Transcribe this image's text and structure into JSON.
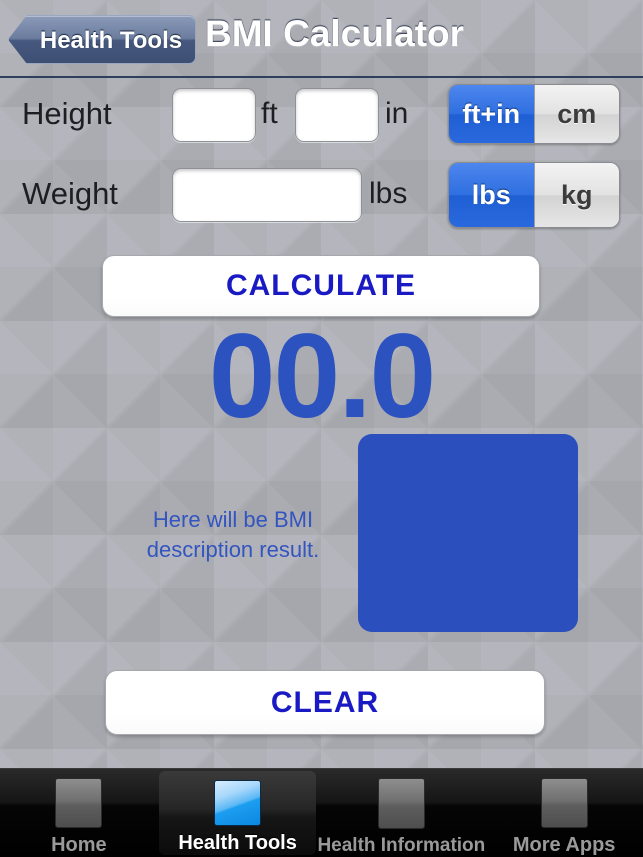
{
  "header": {
    "back_label": "Health Tools",
    "back_icon": "chevron-left-icon",
    "title": "BMI Calculator"
  },
  "form": {
    "height": {
      "label": "Height",
      "feet_value": "",
      "feet_placeholder": "",
      "feet_suffix": "ft",
      "inches_value": "",
      "inches_placeholder": "",
      "inches_suffix": "in",
      "units": [
        {
          "label": "ft+in",
          "selected": true
        },
        {
          "label": "cm",
          "selected": false
        }
      ]
    },
    "weight": {
      "label": "Weight",
      "value": "",
      "placeholder": "",
      "suffix": "lbs",
      "units": [
        {
          "label": "lbs",
          "selected": true
        },
        {
          "label": "kg",
          "selected": false
        }
      ]
    }
  },
  "actions": {
    "calculate_label": "CALCULATE",
    "clear_label": "CLEAR"
  },
  "result": {
    "bmi_value": "00.0",
    "description": "Here will be BMI description result.",
    "image_name": "bmi-chart-placeholder"
  },
  "tabbar": {
    "items": [
      {
        "label": "Home",
        "icon": "home-icon",
        "active": false
      },
      {
        "label": "Health Tools",
        "icon": "health-tools-icon",
        "active": true
      },
      {
        "label": "Health Information",
        "icon": "health-information-icon",
        "active": false
      },
      {
        "label": "More Apps",
        "icon": "more-apps-icon",
        "active": false
      }
    ]
  },
  "colors": {
    "accent_blue": "#2f6fe0",
    "result_blue": "#2c52c0",
    "button_text_blue": "#1a1ac4",
    "navbar_dark": "#43567d",
    "background_gray": "#aeb0b7"
  }
}
